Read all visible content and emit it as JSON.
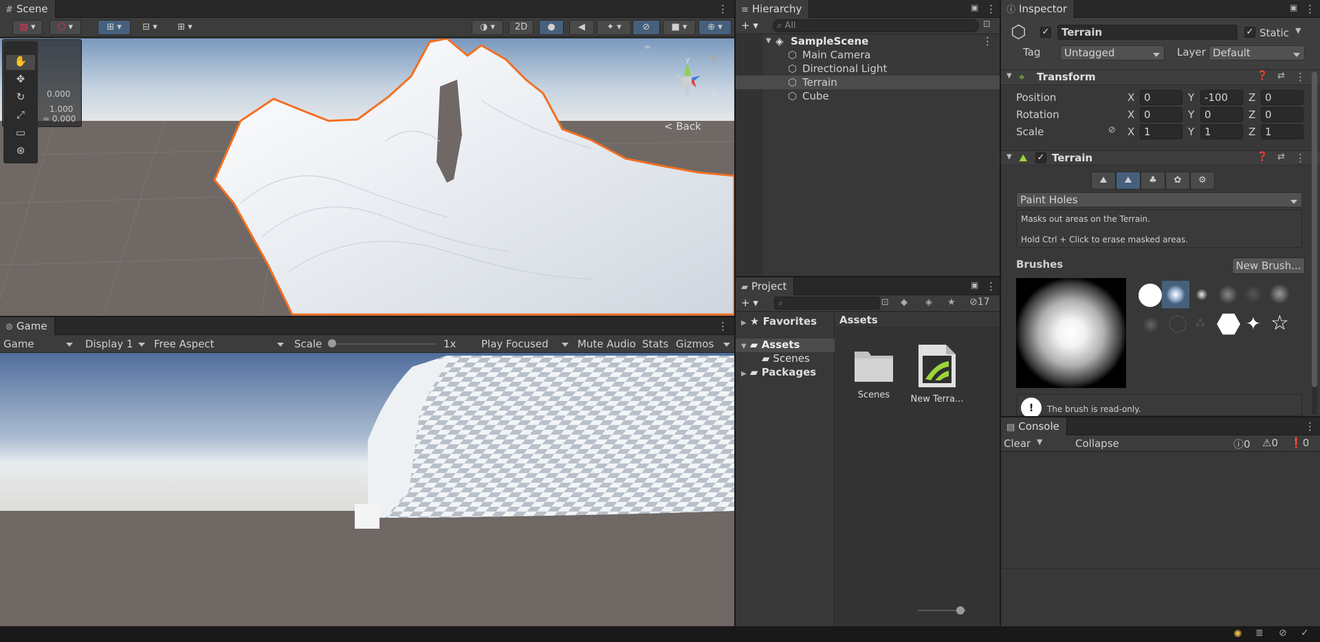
{
  "scene": {
    "tab": "Scene",
    "btn_2d": "2D",
    "nav_back": "Back",
    "gizmo_y": "y",
    "gizmo_x": "x",
    "overlay_vals": [
      "0.000",
      "1.000",
      "= 0.000"
    ]
  },
  "game": {
    "tab": "Game",
    "display_mode": "Game",
    "display": "Display 1",
    "aspect": "Free Aspect",
    "scale_label": "Scale",
    "scale_value": "1x",
    "play_mode": "Play Focused",
    "mute": "Mute Audio",
    "stats": "Stats",
    "gizmos": "Gizmos",
    "scale_fraction": 0.0
  },
  "hierarchy": {
    "tab": "Hierarchy",
    "search_placeholder": "All",
    "scene_name": "SampleScene",
    "items": [
      {
        "label": "Main Camera"
      },
      {
        "label": "Directional Light"
      },
      {
        "label": "Terrain"
      },
      {
        "label": "Cube"
      }
    ],
    "selected": "Terrain"
  },
  "project": {
    "tab": "Project",
    "hidden_count": "17",
    "favorites": "Favorites",
    "assets_label": "Assets",
    "tree": [
      {
        "label": "Assets"
      },
      {
        "label": "Scenes"
      },
      {
        "label": "Packages"
      }
    ],
    "breadcrumb": "Assets",
    "files": [
      {
        "label": "Scenes"
      },
      {
        "label": "New Terra..."
      }
    ]
  },
  "inspector": {
    "tab": "Inspector",
    "object_name": "Terrain",
    "static_label": "Static",
    "tag_label": "Tag",
    "tag_value": "Untagged",
    "layer_label": "Layer",
    "layer_value": "Default",
    "transform": {
      "title": "Transform",
      "rows": [
        {
          "label": "Position",
          "x": "0",
          "y": "-100",
          "z": "0"
        },
        {
          "label": "Rotation",
          "x": "0",
          "y": "0",
          "z": "0"
        },
        {
          "label": "Scale",
          "x": "1",
          "y": "1",
          "z": "1"
        }
      ],
      "axis_x": "X",
      "axis_y": "Y",
      "axis_z": "Z"
    },
    "terrain": {
      "title": "Terrain",
      "tool": "Paint Holes",
      "help1": "Masks out areas on the Terrain.",
      "help2": "Hold Ctrl + Click to erase masked areas.",
      "brushes_label": "Brushes",
      "new_brush": "New Brush...",
      "readonly": "The brush is read-only."
    }
  },
  "console": {
    "tab": "Console",
    "clear": "Clear",
    "collapse": "Collapse",
    "log_count": "0",
    "warn_count": "0",
    "error_count": "0"
  },
  "colors": {
    "accent": "#46607c",
    "selection_outline": "#f26f22",
    "bg": "#383838",
    "dark": "#282828"
  }
}
